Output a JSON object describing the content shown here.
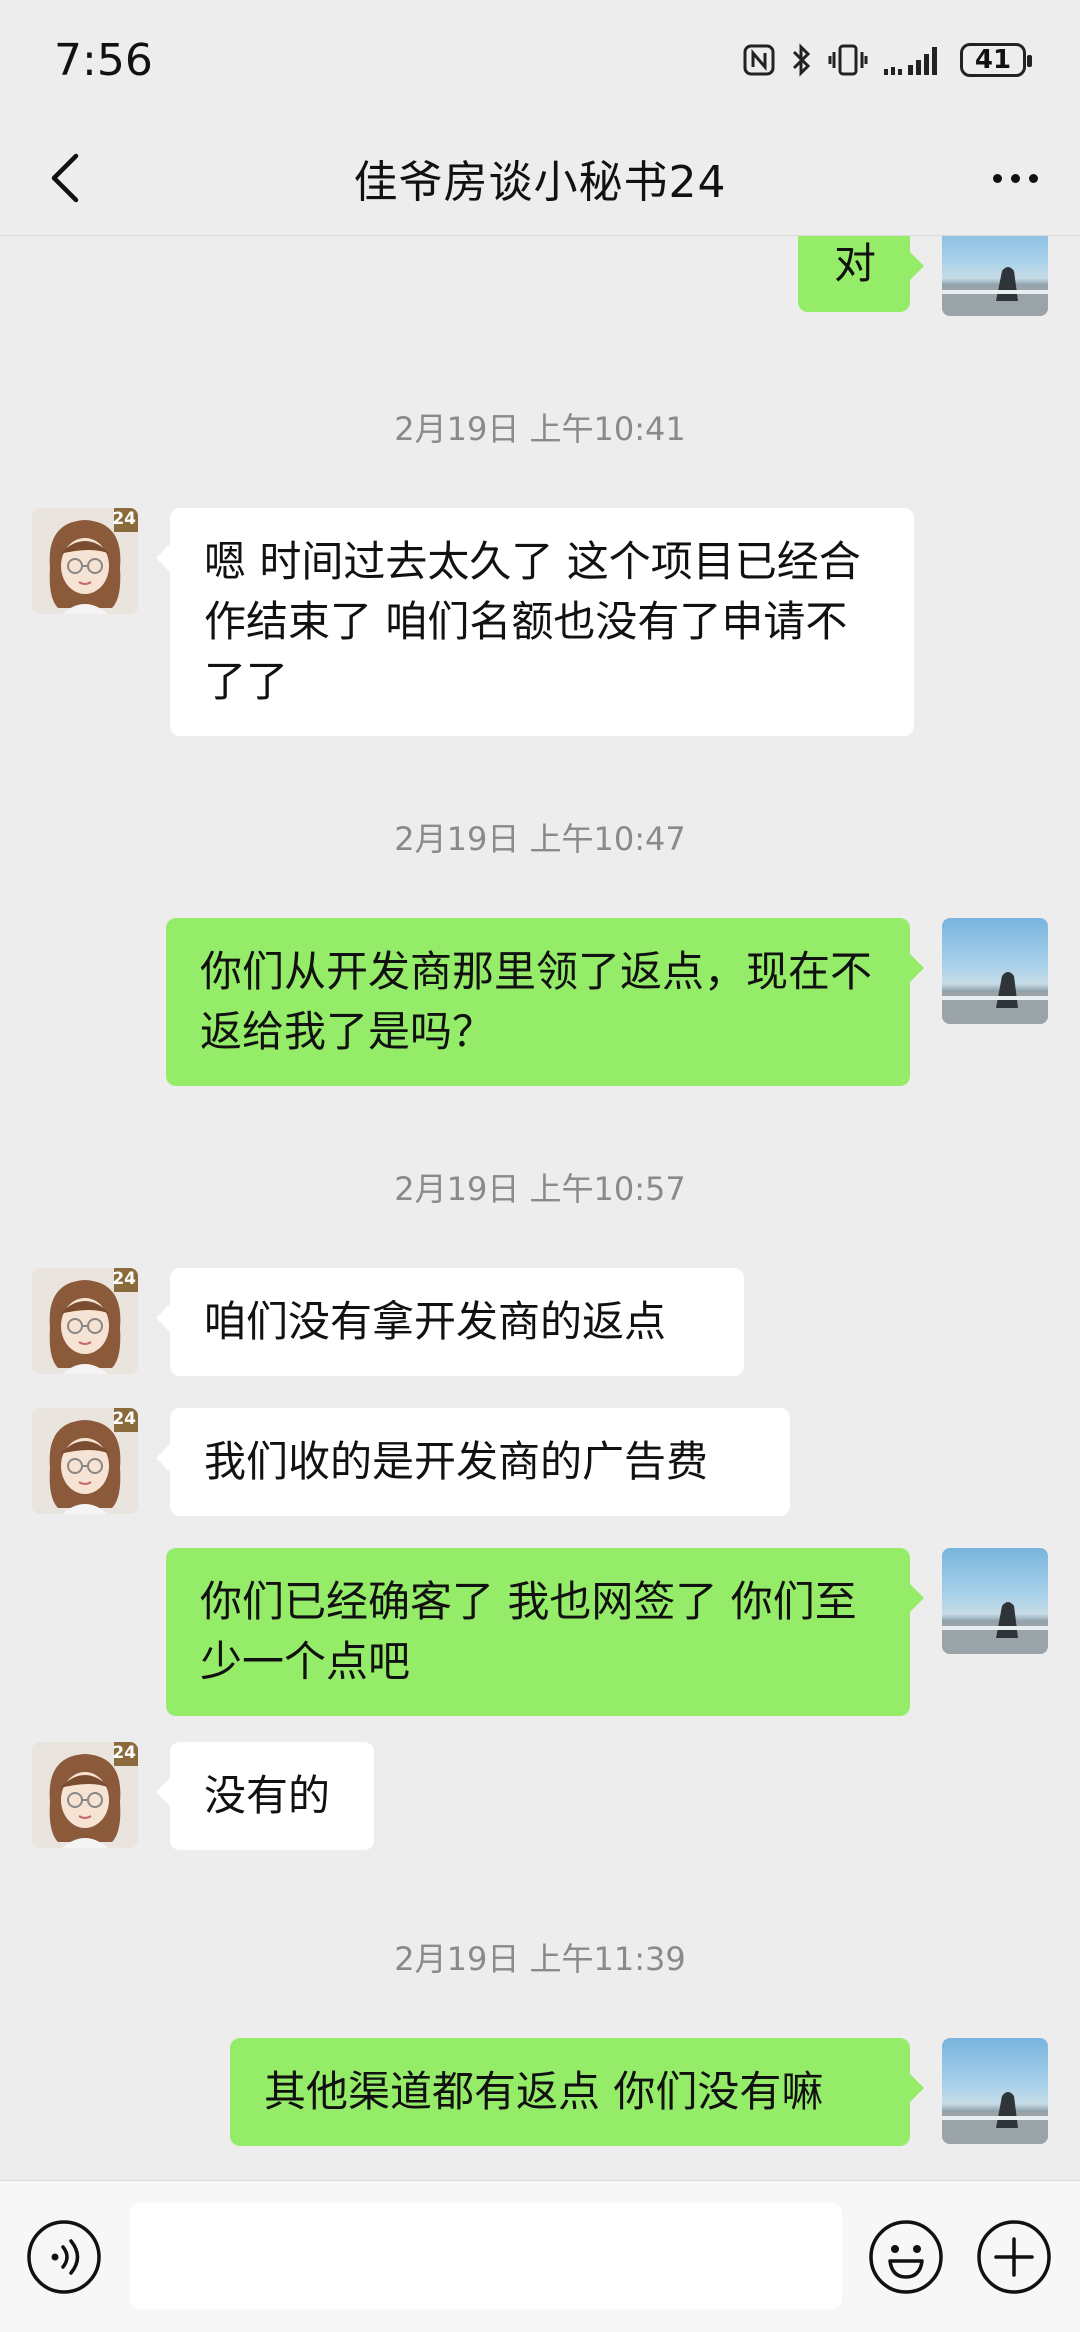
{
  "status_bar": {
    "time": "7:56",
    "icons": [
      "nfc-icon",
      "bluetooth-icon",
      "vibrate-icon",
      "signal-icon"
    ],
    "battery": "41"
  },
  "header": {
    "title": "佳爷房谈小秘书24"
  },
  "avatar_badge": "24",
  "messages": [
    {
      "sender": "me",
      "text": "对"
    },
    {
      "type": "time",
      "text": "2月19日 上午10:41"
    },
    {
      "sender": "other",
      "text": "嗯 时间过去太久了 这个项目已经合作结束了 咱们名额也没有了申请不了了"
    },
    {
      "type": "time",
      "text": "2月19日 上午10:47"
    },
    {
      "sender": "me",
      "text": "你们从开发商那里领了返点，现在不返给我了是吗？"
    },
    {
      "type": "time",
      "text": "2月19日 上午10:57"
    },
    {
      "sender": "other",
      "text": "咱们没有拿开发商的返点"
    },
    {
      "sender": "other",
      "text": "我们收的是开发商的广告费"
    },
    {
      "sender": "me",
      "text": "你们已经确客了 我也网签了 你们至少一个点吧"
    },
    {
      "sender": "other",
      "text": "没有的"
    },
    {
      "type": "time",
      "text": "2月19日 上午11:39"
    },
    {
      "sender": "me",
      "text": "其他渠道都有返点 你们没有嘛"
    }
  ],
  "input_bar": {
    "text_value": "",
    "icons": [
      "voice-icon",
      "emoji-icon",
      "plus-icon"
    ]
  },
  "colors": {
    "background": "#ededed",
    "my_bubble": "#95ec69",
    "other_bubble": "#ffffff",
    "timestamp": "#8a8a8a"
  }
}
